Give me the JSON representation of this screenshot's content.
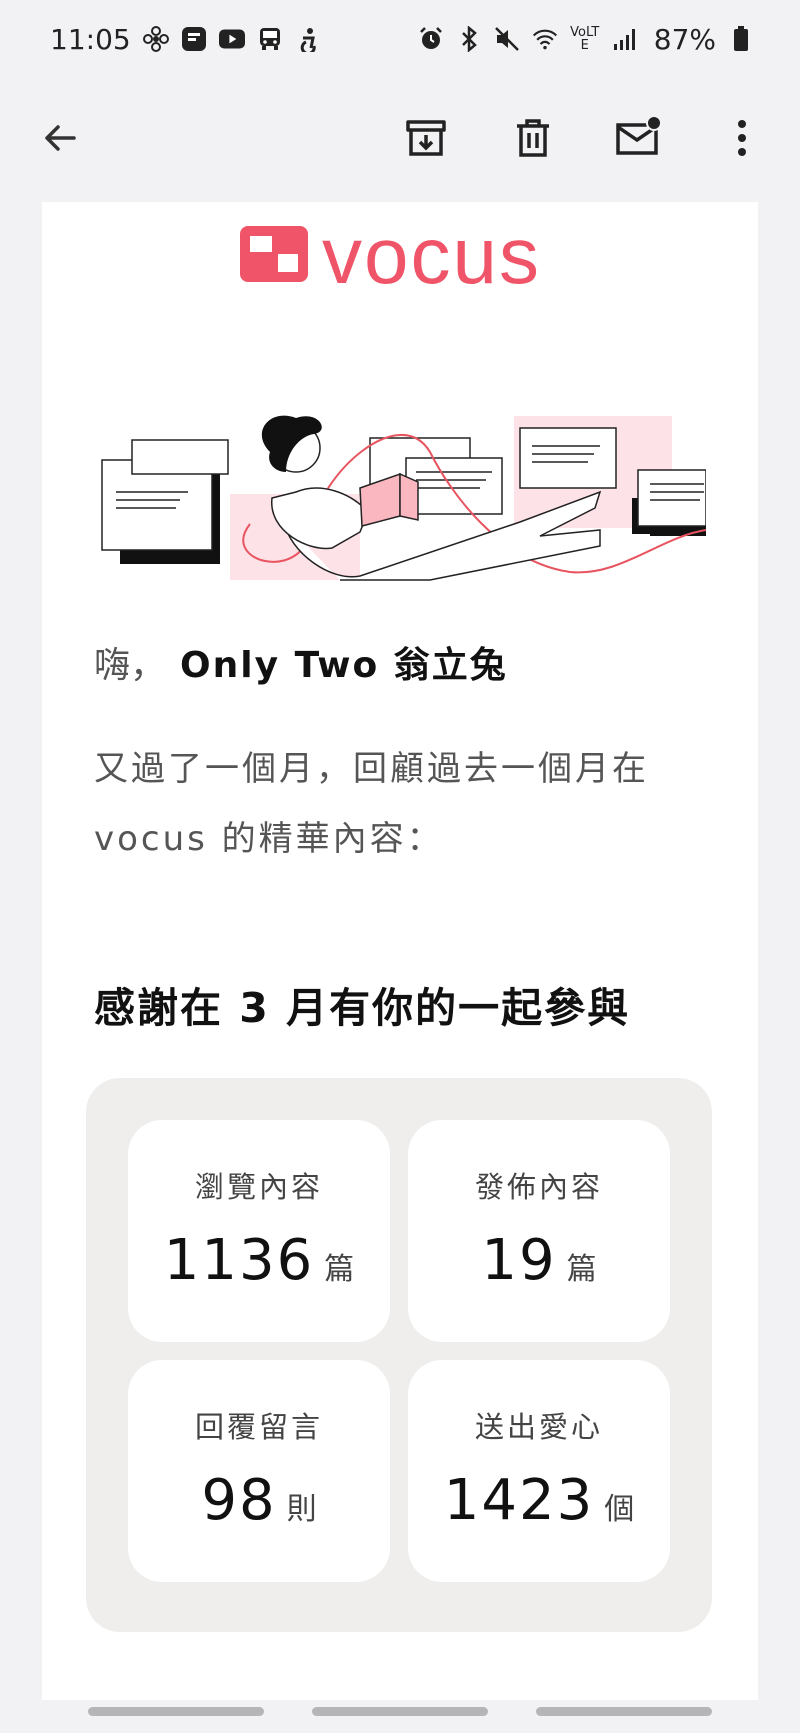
{
  "status_bar": {
    "time": "11:05",
    "left_icons": [
      "fan-icon",
      "news-app-icon",
      "youtube-icon",
      "bus-icon",
      "accessibility-icon"
    ],
    "right_icons": [
      "alarm-icon",
      "bluetooth-icon",
      "mute-icon",
      "wifi-icon",
      "volte-icon",
      "signal-icon"
    ],
    "volte_label": "VoLTE",
    "battery": "87%"
  },
  "app_bar": {
    "actions": [
      "back-arrow-icon",
      "archive-icon",
      "delete-icon",
      "mark-unread-icon",
      "more-vert-icon"
    ]
  },
  "email": {
    "logo_text": "vocus",
    "brand_color": "#f05468",
    "greeting_prefix": "嗨，",
    "recipient_name": "Only Two 翁立兔",
    "intro_text": "又過了一個月，回顧過去一個月在 vocus 的精華內容：",
    "section_title": "感謝在 3 月有你的一起參與",
    "stats": [
      {
        "label": "瀏覽內容",
        "value": "1136",
        "unit": "篇"
      },
      {
        "label": "發佈內容",
        "value": "19",
        "unit": "篇"
      },
      {
        "label": "回覆留言",
        "value": "98",
        "unit": "則"
      },
      {
        "label": "送出愛心",
        "value": "1423",
        "unit": "個"
      }
    ]
  }
}
